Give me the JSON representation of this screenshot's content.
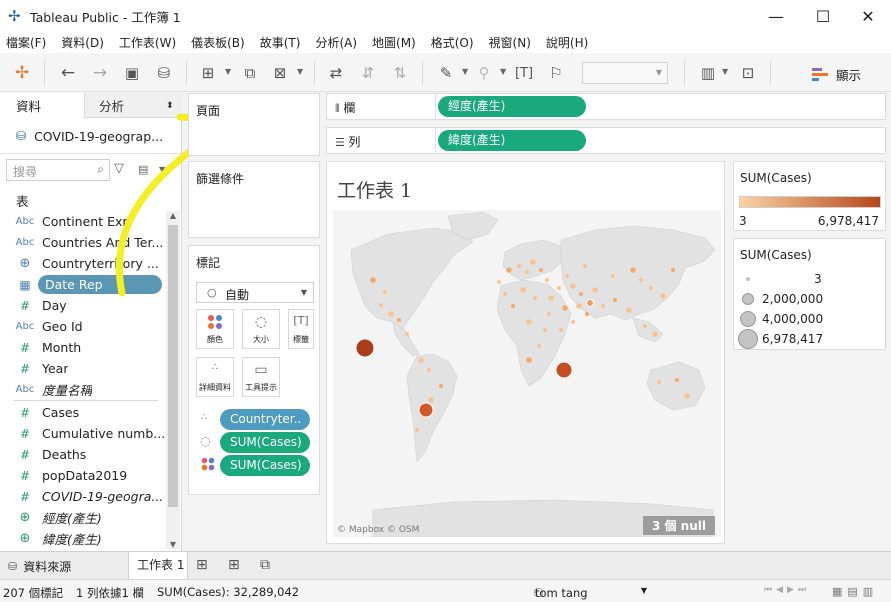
{
  "window": {
    "title": "Tableau Public - 工作簿 1",
    "minimize": "—",
    "maximize": "☐",
    "close": "✕"
  },
  "menu": [
    "檔案(F)",
    "資料(D)",
    "工作表(W)",
    "儀表板(B)",
    "故事(T)",
    "分析(A)",
    "地圖(M)",
    "格式(O)",
    "視窗(N)",
    "說明(H)"
  ],
  "toolbar": {
    "show_me_label": "顯示",
    "accent": "#e97627"
  },
  "left_pane": {
    "tabs": [
      "資料",
      "分析"
    ],
    "datasource": "COVID-19-geograp...",
    "search_placeholder": "搜尋",
    "section_tables": "表",
    "fields": [
      {
        "type": "Abc",
        "name": "Continent Exp"
      },
      {
        "type": "Abc",
        "name": "Countries And Ter..."
      },
      {
        "type": "globe",
        "name": "Countryterritory ..."
      },
      {
        "type": "date",
        "name": "Date Rep"
      },
      {
        "type": "#",
        "name": "Day"
      },
      {
        "type": "Abc",
        "name": "Geo Id"
      },
      {
        "type": "#",
        "name": "Month"
      },
      {
        "type": "#",
        "name": "Year"
      },
      {
        "type": "Abc",
        "name": "度量名稱"
      },
      {
        "type": "#",
        "name": "Cases"
      },
      {
        "type": "#",
        "name": "Cumulative numb..."
      },
      {
        "type": "#",
        "name": "Deaths"
      },
      {
        "type": "#",
        "name": "popData2019"
      },
      {
        "type": "#",
        "name": "COVID-19-geogra..."
      },
      {
        "type": "globe",
        "name": "經度(產生)"
      },
      {
        "type": "globe",
        "name": "緯度(產生)"
      }
    ]
  },
  "shelves": {
    "pages_label": "頁面",
    "filters_label": "篩選條件",
    "marks_label": "標記",
    "mark_type": "自動",
    "mark_buttons": [
      "顏色",
      "大小",
      "標籤",
      "詳細資料",
      "工具提示"
    ],
    "mark_pills": [
      "Countryter..",
      "SUM(Cases)",
      "SUM(Cases)"
    ],
    "columns_label": "欄",
    "columns_pill": "經度(產生)",
    "rows_label": "列",
    "rows_pill": "緯度(產生)"
  },
  "sheet": {
    "title": "工作表 1",
    "attribution": "© Mapbox © OSM",
    "null_badge": "3 個 null"
  },
  "legend_color": {
    "title": "SUM(Cases)",
    "min": "3",
    "max": "6,978,417",
    "color_low": "#fbd3a4",
    "color_high": "#b6461a"
  },
  "legend_size": {
    "title": "SUM(Cases)",
    "items": [
      "3",
      "2,000,000",
      "4,000,000",
      "6,978,417"
    ]
  },
  "tabs": {
    "datasource": "資料來源",
    "sheet1": "工作表 1"
  },
  "status": {
    "marks": "207 個標記",
    "rows_cols": "1 列依據1 欄",
    "sum": "SUM(Cases): 32,289,042",
    "user": "tom tang"
  }
}
